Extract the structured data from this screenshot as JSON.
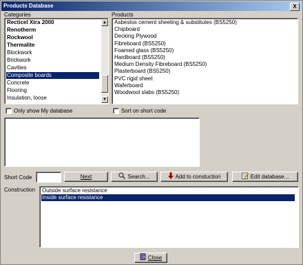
{
  "window": {
    "title": "Products Database",
    "close_glyph": "X"
  },
  "categories": {
    "label": "Categories",
    "items": [
      {
        "label": "Recticel Xtra 2000",
        "bold": true
      },
      {
        "label": "Renotherm",
        "bold": true
      },
      {
        "label": "Rockwool",
        "bold": true
      },
      {
        "label": "Thermalite",
        "bold": true
      },
      {
        "label": "Blockwork",
        "bold": false
      },
      {
        "label": "Brickwork",
        "bold": false
      },
      {
        "label": "Cavities",
        "bold": false
      },
      {
        "label": "Composite boards",
        "bold": false,
        "selected": true
      },
      {
        "label": "Concrete",
        "bold": false
      },
      {
        "label": "Flooring",
        "bold": false
      },
      {
        "label": "Insulation, loose",
        "bold": false
      }
    ]
  },
  "products": {
    "label": "Products",
    "items": [
      "Asbestos cement sheeting & substitutes (BS5250)",
      "Chipboard",
      "Decking Plywood",
      "Fibreboard (BS5250)",
      "Foamed glass (BS5250)",
      "Hardboard (BS5250)",
      "Medium Density Fibreboard (BS5250)",
      "Plasterboard (BS5250)",
      "PVC rigid sheet",
      "Waferboard",
      "Woodwool slabs (BS5250)"
    ]
  },
  "options": {
    "only_my_db": "Only show My database",
    "sort_short_code": "Sort on short code"
  },
  "short_code": {
    "label": "Short Code",
    "value": ""
  },
  "buttons": {
    "next": "Next",
    "search": "Search...",
    "add": "Add to constuction",
    "edit": "Edit database...",
    "close": "Close"
  },
  "construction": {
    "label": "Construction",
    "items": [
      {
        "label": "Outside surface resistance",
        "selected": false
      },
      {
        "label": "Inside surface resistance",
        "selected": true
      }
    ]
  },
  "colors": {
    "selection": "#0a246a",
    "face": "#d4d0c8"
  }
}
